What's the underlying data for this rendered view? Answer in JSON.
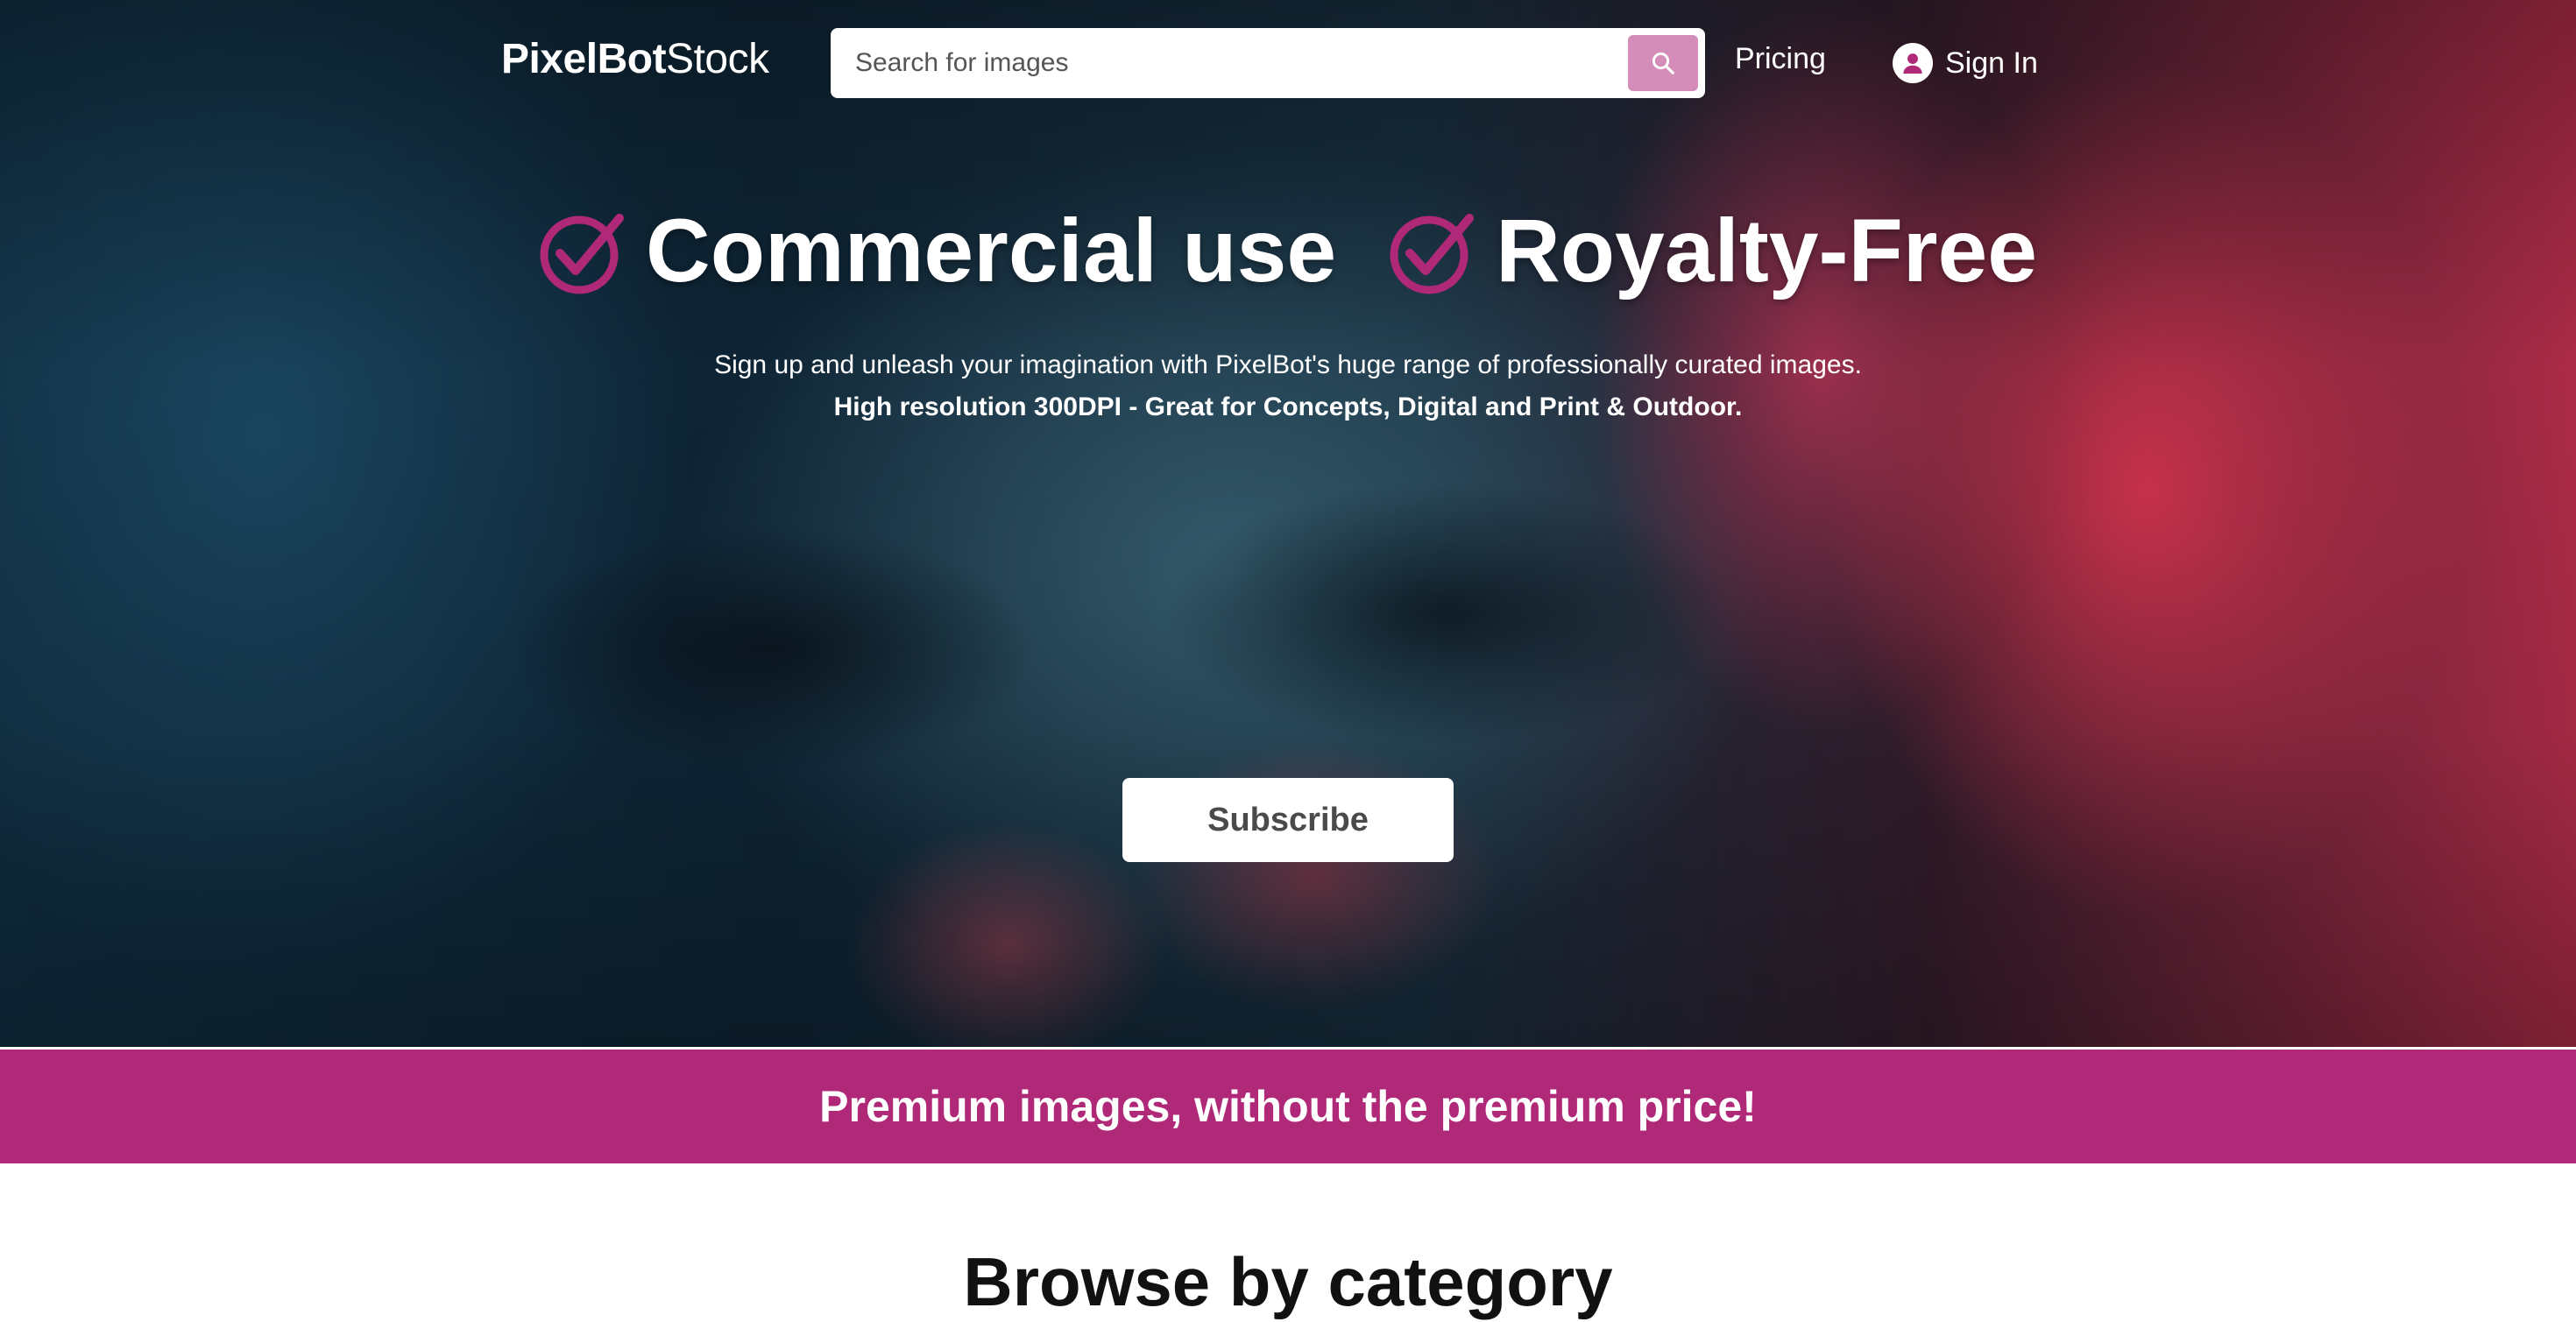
{
  "header": {
    "logo_bold": "PixelBot",
    "logo_light": "Stock",
    "search_placeholder": "Search for images",
    "pricing_label": "Pricing",
    "signin_label": "Sign In"
  },
  "hero": {
    "feature_1": "Commercial use",
    "feature_2": "Royalty-Free",
    "subtitle": "Sign up and unleash your imagination with PixelBot's huge range of professionally curated images.",
    "subtitle_bold": "High resolution 300DPI - Great for Concepts, Digital and Print & Outdoor.",
    "subscribe_label": "Subscribe"
  },
  "banner": {
    "text": "Premium images, without the premium price!"
  },
  "browse": {
    "heading": "Browse by category"
  },
  "colors": {
    "brand": "#b02878",
    "search_button": "#d48db8",
    "check": "#b02878"
  },
  "icons": {
    "search": "search-icon",
    "user": "user-icon",
    "check": "check-circle-icon"
  }
}
